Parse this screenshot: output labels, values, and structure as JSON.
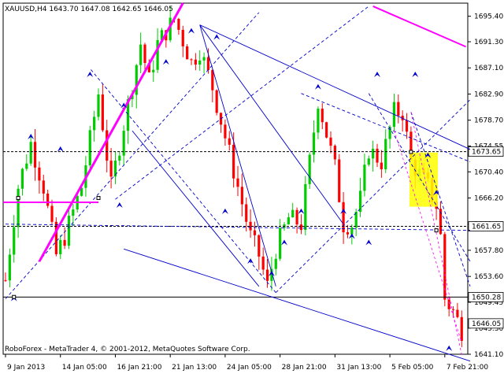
{
  "header": {
    "symbol": "XAUUSD,H4",
    "ohlc": "1643.70 1647.08 1642.65 1646.05"
  },
  "footer": {
    "copyright": "RoboForex - MetaTrader 4, © 2001-2012, MetaQuotes Software Corp."
  },
  "colors": {
    "bull": "#00cc00",
    "bear": "#ff0000",
    "trend_blue": "#0000cc",
    "magenta": "#ff00ff",
    "highlight": "#ffff00",
    "grid_text": "#000000"
  },
  "chart_data": {
    "type": "candlestick",
    "title": "XAUUSD,H4",
    "ylim": [
      1641.1,
      1697.5
    ],
    "y_ticks": [
      1695.4,
      1691.3,
      1687.1,
      1682.9,
      1678.7,
      1674.55,
      1670.4,
      1666.2,
      1662.0,
      1657.8,
      1653.6,
      1649.45,
      1645.3,
      1641.1
    ],
    "x_ticks": [
      "9 Jan 2013",
      "14 Jan 05:00",
      "16 Jan 21:00",
      "21 Jan 13:00",
      "24 Jan 05:00",
      "28 Jan 21:00",
      "31 Jan 13:00",
      "5 Feb 05:00",
      "7 Feb 21:00"
    ],
    "price_levels": [
      {
        "value": 1673.65,
        "label": "1673.65",
        "style": "dashed"
      },
      {
        "value": 1661.65,
        "label": "1661.65",
        "style": "dashed"
      },
      {
        "value": 1650.28,
        "label": "1650.28",
        "style": "solid"
      },
      {
        "value": 1646.05,
        "label": "1646.05",
        "style": "current"
      }
    ],
    "path": [
      [
        0,
        1653
      ],
      [
        3,
        1668
      ],
      [
        6,
        1675
      ],
      [
        9,
        1668
      ],
      [
        12,
        1657
      ],
      [
        14,
        1660
      ],
      [
        18,
        1668
      ],
      [
        22,
        1683
      ],
      [
        25,
        1668
      ],
      [
        28,
        1678
      ],
      [
        32,
        1691
      ],
      [
        34,
        1685
      ],
      [
        36,
        1691
      ],
      [
        40,
        1695
      ],
      [
        44,
        1688
      ],
      [
        46,
        1690
      ],
      [
        49,
        1684
      ],
      [
        52,
        1676
      ],
      [
        55,
        1668
      ],
      [
        58,
        1660
      ],
      [
        60,
        1657
      ],
      [
        62,
        1652
      ],
      [
        64,
        1658
      ],
      [
        67,
        1663
      ],
      [
        70,
        1662
      ],
      [
        74,
        1682
      ],
      [
        78,
        1671
      ],
      [
        80,
        1662
      ],
      [
        82,
        1662
      ],
      [
        84,
        1666
      ],
      [
        86,
        1674
      ],
      [
        89,
        1672
      ],
      [
        92,
        1680
      ],
      [
        94,
        1680
      ],
      [
        96,
        1672
      ],
      [
        98,
        1670
      ],
      [
        100,
        1668
      ],
      [
        102,
        1665
      ],
      [
        103,
        1660
      ],
      [
        104,
        1650
      ],
      [
        106,
        1648
      ],
      [
        108,
        1645
      ]
    ]
  }
}
